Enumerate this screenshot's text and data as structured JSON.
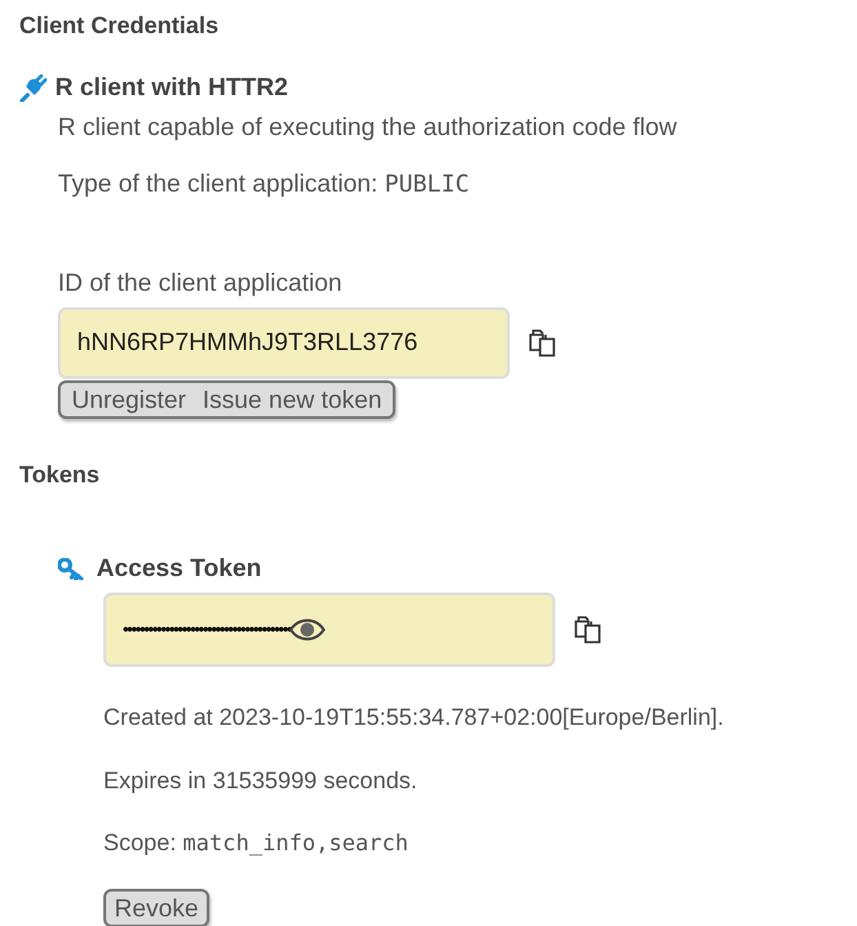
{
  "client_credentials": {
    "heading": "Client Credentials",
    "client": {
      "name": "R client with HTTR2",
      "description": "R client capable of executing the authorization code flow",
      "type_label": "Type of the client application:",
      "type_value": "PUBLIC",
      "id_label": "ID of the client application",
      "id_value": "hNN6RP7HMMhJ9T3RLL3776",
      "buttons": [
        "Unregister",
        "Issue new token"
      ]
    }
  },
  "tokens": {
    "heading": "Tokens",
    "token": {
      "title": "Access Token",
      "value": "••••••••••••••••••••••••••••••••••••••••",
      "created": "Created at 2023-10-19T15:55:34.787+02:00[Europe/Berlin].",
      "expires": "Expires in 31535999 seconds.",
      "scope_label": "Scope:",
      "scope_value": "match_info,search",
      "button": "Revoke"
    }
  }
}
